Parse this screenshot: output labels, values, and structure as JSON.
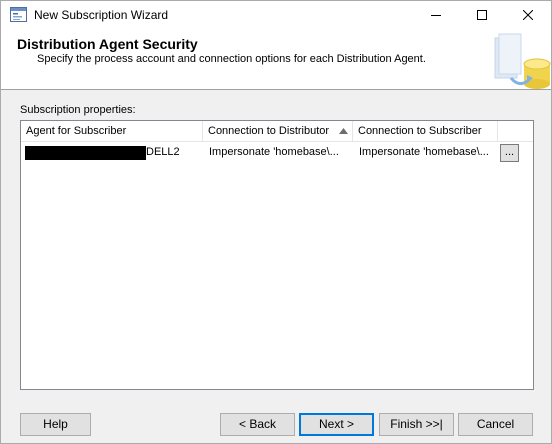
{
  "window": {
    "title": "New Subscription Wizard",
    "icon": "wizard-app-icon"
  },
  "header": {
    "title": "Distribution Agent Security",
    "subtitle": "Specify the process account and connection options for each Distribution Agent.",
    "graphic": "database-graphic-icon"
  },
  "properties": {
    "label": "Subscription properties:",
    "columns": [
      "Agent for Subscriber",
      "Connection to Distributor",
      "Connection to Subscriber",
      ""
    ],
    "sorted_column": "Connection to Distributor",
    "rows": [
      {
        "agent_suffix": "DELL2",
        "agent_redacted": true,
        "distributor_connection": "Impersonate 'homebase\\...",
        "subscriber_connection": "Impersonate 'homebase\\...",
        "button": "..."
      }
    ]
  },
  "buttons": {
    "help": "Help",
    "back": "< Back",
    "next": "Next >",
    "finish": "Finish >>|",
    "cancel": "Cancel"
  }
}
